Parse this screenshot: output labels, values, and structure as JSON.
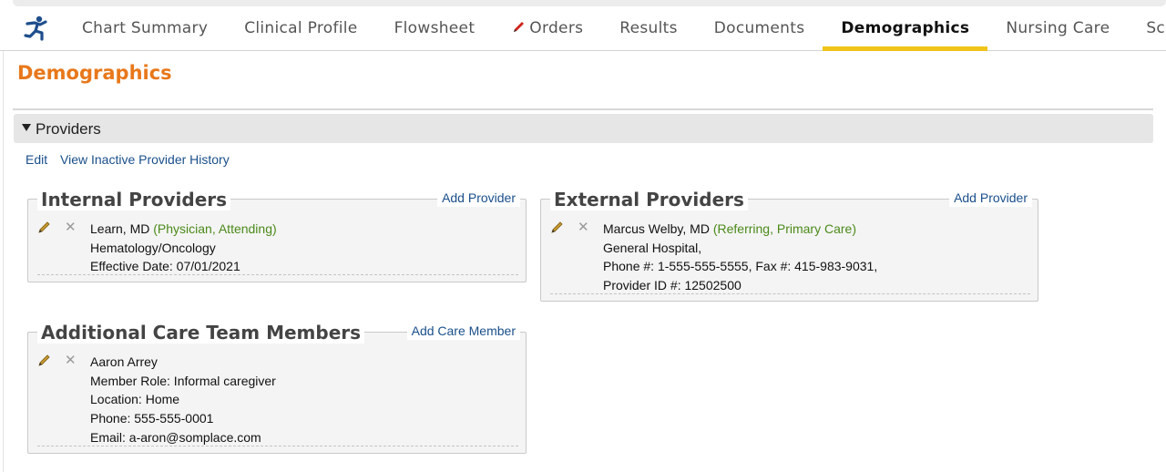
{
  "nav": {
    "tabs": [
      {
        "label": "Chart Summary"
      },
      {
        "label": "Clinical Profile"
      },
      {
        "label": "Flowsheet"
      },
      {
        "label": "Orders"
      },
      {
        "label": "Results"
      },
      {
        "label": "Documents"
      },
      {
        "label": "Demographics",
        "active": true
      },
      {
        "label": "Nursing Care"
      },
      {
        "label": "Sch"
      }
    ],
    "accent_color": "#f0c419"
  },
  "page": {
    "title": "Demographics",
    "title_color": "#e8781b"
  },
  "providers_section": {
    "label": "Providers",
    "actions": {
      "edit": "Edit",
      "history": "View Inactive Provider History"
    },
    "internal": {
      "title": "Internal Providers",
      "add_link": "Add Provider",
      "entry": {
        "name": "Learn, MD",
        "roles": "(Physician, Attending)",
        "specialty": "Hematology/Oncology",
        "effective": "Effective Date: 07/01/2021"
      }
    },
    "external": {
      "title": "External Providers",
      "add_link": "Add Provider",
      "entry": {
        "name": "Marcus Welby, MD",
        "roles": "(Referring, Primary Care)",
        "org": "General Hospital,",
        "contact": "Phone #: 1-555-555-5555, Fax #: 415-983-9031,",
        "provider_id": "Provider ID #: 12502500"
      }
    },
    "care_team": {
      "title": "Additional Care Team Members",
      "add_link": "Add Care Member",
      "entry": {
        "name": "Aaron Arrey",
        "role": "Member Role: Informal caregiver",
        "location": "Location: Home",
        "phone": "Phone: 555-555-0001",
        "email": "Email: a-aron@somplace.com"
      }
    }
  },
  "colors": {
    "link": "#1a4f8b",
    "role_text": "#4b8a1a"
  }
}
